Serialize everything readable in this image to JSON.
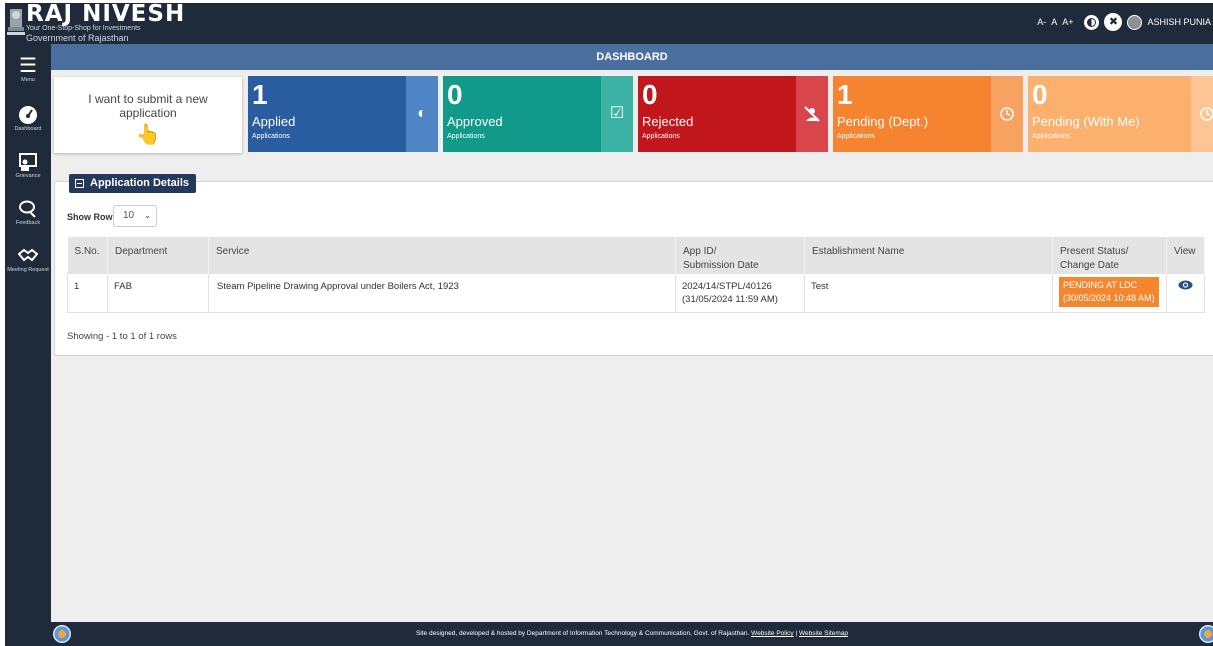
{
  "header": {
    "brand_title": "RAJ NIVESH",
    "brand_tagline": "Your One-Stop-Shop for Investments",
    "brand_gov": "Government of Rajasthan",
    "font_small": "A-",
    "font_normal": "A",
    "font_large": "A+",
    "user_name": "ASHISH PUNIA"
  },
  "sidebar": {
    "items": [
      {
        "label": "Menu",
        "icon": "hamburger-icon"
      },
      {
        "label": "Dashboard",
        "icon": "speedometer-icon"
      },
      {
        "label": "Grievance",
        "icon": "grievance-icon"
      },
      {
        "label": "Feedback",
        "icon": "chat-icon"
      },
      {
        "label": "Meeting Request",
        "icon": "handshake-icon"
      }
    ]
  },
  "page_title": "DASHBOARD",
  "submit_card": {
    "text": "I want to submit a new application"
  },
  "cards": [
    {
      "count": "1",
      "label": "Applied",
      "sub": "Applications",
      "color": "#2a5da0",
      "side_color": "#4f85c4",
      "icon": "contrast-icon"
    },
    {
      "count": "0",
      "label": "Approved",
      "sub": "Applications",
      "color": "#119a8a",
      "side_color": "#3db3a5",
      "icon": "checkbox-icon"
    },
    {
      "count": "0",
      "label": "Rejected",
      "sub": "Applications",
      "color": "#c0161c",
      "side_color": "#d8464b",
      "icon": "user-slash-icon"
    },
    {
      "count": "1",
      "label": "Pending (Dept.)",
      "sub": "Applications",
      "color": "#f58330",
      "side_color": "#f8a261",
      "icon": "clock-icon"
    },
    {
      "count": "0",
      "label": "Pending (With Me)",
      "sub": "Applications",
      "color": "#fbb06e",
      "side_color": "#fcc593",
      "icon": "clock-icon"
    }
  ],
  "panel": {
    "title": "Application Details",
    "show_rows_label": "Show Rows",
    "show_rows_value": "10",
    "showing_text": "Showing - 1 to 1 of 1 rows"
  },
  "table": {
    "headers": {
      "sno": "S.No.",
      "department": "Department",
      "service": "Service",
      "appid_1": "App ID/",
      "appid_2": "Submission Date",
      "establishment": "Establishment Name",
      "status_1": "Present Status/",
      "status_2": "Change Date",
      "view": "View"
    },
    "rows": [
      {
        "sno": "1",
        "department": "FAB",
        "service": "Steam Pipeline Drawing Approval under Boilers Act, 1923",
        "app_id": "2024/14/STPL/40126",
        "submission_date": "(31/05/2024 11:59 AM)",
        "establishment": "Test",
        "status": "PENDING AT LDC",
        "status_date": "(30/05/2024 10:48 AM)"
      }
    ]
  },
  "footer": {
    "text": "Site designed, developed & hosted by Department of Information Technology & Communication, Govt. of Rajasthan.",
    "policy_link": "Website Policy",
    "separator": "|",
    "sitemap_link": "Website Sitemap"
  }
}
